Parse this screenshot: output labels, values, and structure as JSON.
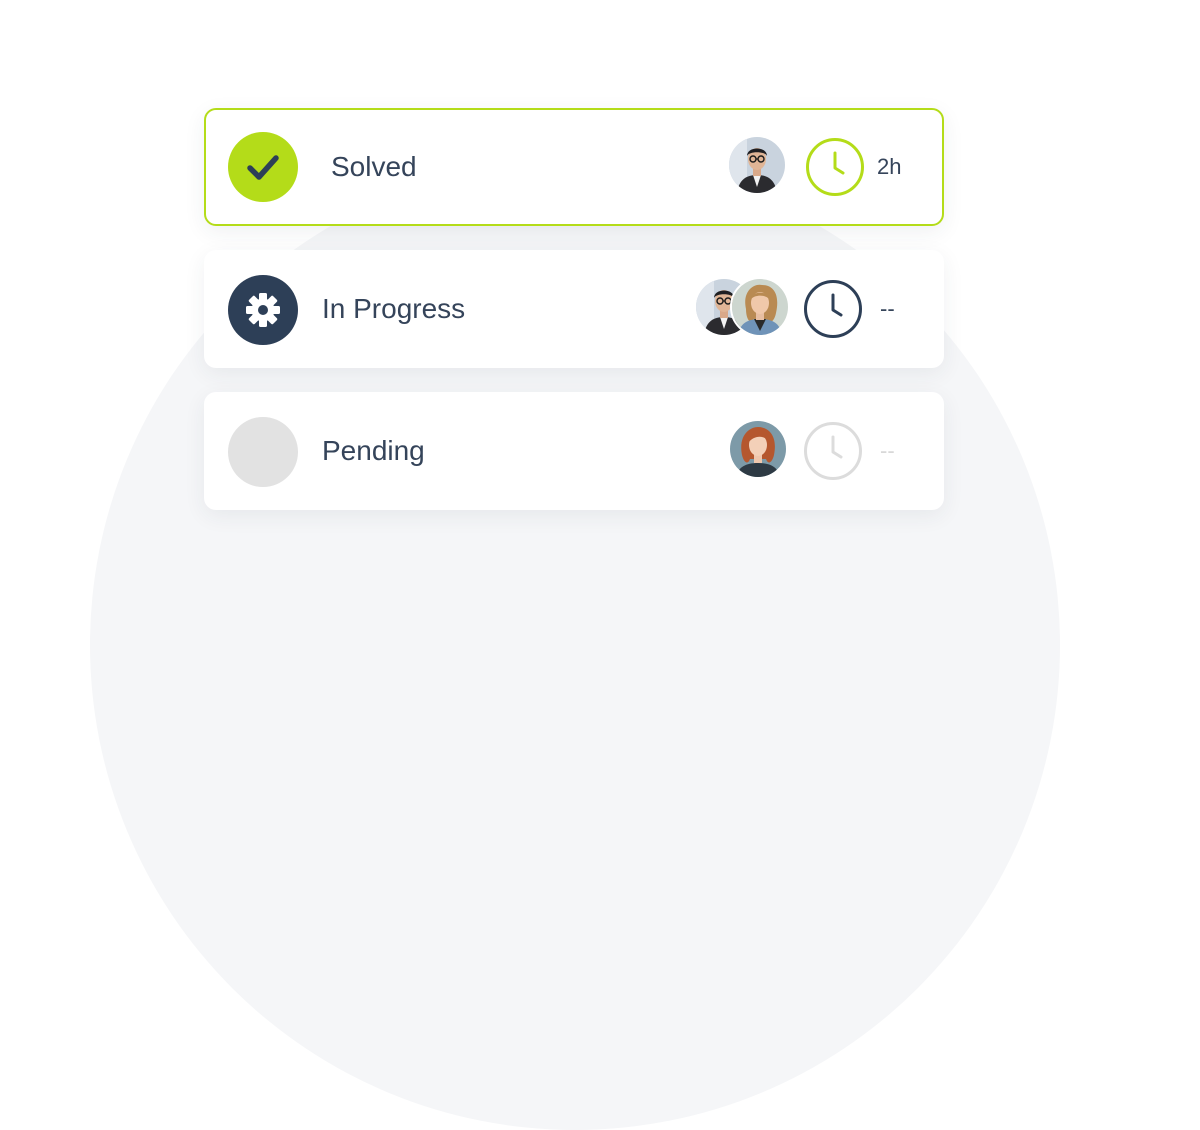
{
  "colors": {
    "accent": "#b4dc19",
    "in_progress": "#2d3f57",
    "pending": "#e2e2e2",
    "text": "#35445a"
  },
  "tasks": [
    {
      "status": "Solved",
      "status_icon": "check-icon",
      "assignees": [
        "avatar-man-glasses"
      ],
      "time_icon": "clock-icon",
      "time": "2h"
    },
    {
      "status": "In Progress",
      "status_icon": "gear-icon",
      "assignees": [
        "avatar-man-glasses",
        "avatar-woman-curly-hair"
      ],
      "time_icon": "clock-icon",
      "time": "--"
    },
    {
      "status": "Pending",
      "status_icon": "empty-circle-icon",
      "assignees": [
        "avatar-woman-red-hair"
      ],
      "time_icon": "clock-icon",
      "time": "--"
    }
  ]
}
